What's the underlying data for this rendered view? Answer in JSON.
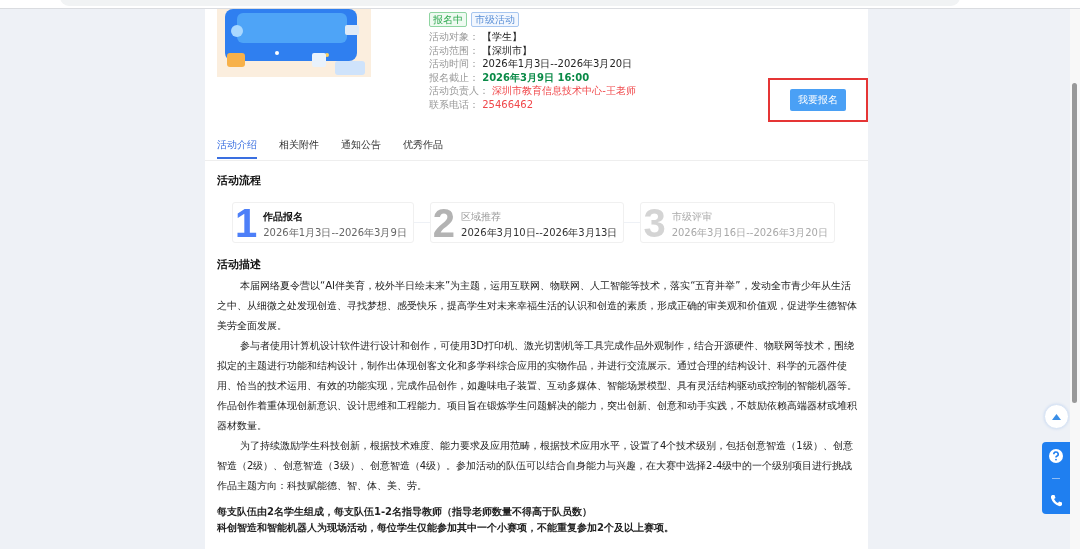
{
  "activity": {
    "tags": [
      {
        "label": "报名中",
        "kind": "status"
      },
      {
        "label": "市级活动",
        "kind": "level"
      }
    ],
    "info": [
      {
        "label": "活动对象：",
        "value": "【学生】",
        "kind": "plain"
      },
      {
        "label": "活动范围：",
        "value": "【深圳市】",
        "kind": "plain"
      },
      {
        "label": "活动时间：",
        "value": "2026年1月3日--2026年3月20日",
        "kind": "plain"
      },
      {
        "label": "报名截止：",
        "value": "2026年3月9日 16:00",
        "kind": "deadline"
      },
      {
        "label": "活动负责人：",
        "value": "深圳市教育信息技术中心-王老师",
        "kind": "contact"
      },
      {
        "label": "联系电话：",
        "value": "25466462",
        "kind": "contact"
      }
    ],
    "signup_button": {
      "label": "我要报名",
      "highlighted": true
    }
  },
  "tabs": [
    {
      "label": "活动介绍",
      "selected": true
    },
    {
      "label": "相关附件",
      "selected": false
    },
    {
      "label": "通知公告",
      "selected": false
    },
    {
      "label": "优秀作品",
      "selected": false
    }
  ],
  "process": {
    "title": "活动流程",
    "steps": [
      {
        "number": "1",
        "name": "作品报名",
        "dates": "2026年1月3日--2026年3月9日",
        "kind": "current"
      },
      {
        "number": "2",
        "name": "区域推荐",
        "dates": "2026年3月10日--2026年3月13日",
        "kind": "next"
      },
      {
        "number": "3",
        "name": "市级评审",
        "dates": "2026年3月16日--2026年3月20日",
        "kind": "future"
      }
    ]
  },
  "description": {
    "title": "活动描述",
    "paragraphs": [
      {
        "text": "本届网络夏令营以“AI伴美育，校外半日绘未来”为主题，运用互联网、物联网、人工智能等技术，落实“五育并举”，发动全市青少年从生活之中、从细微之处发现创造、寻找梦想、感受快乐，提高学生对未来幸福生活的认识和创造的素质，形成正确的审美观和价值观，促进学生德智体美劳全面发展。",
        "kind": "indent"
      },
      {
        "text": "参与者使用计算机设计软件进行设计和创作，可使用3D打印机、激光切割机等工具完成作品外观制作，结合开源硬件、物联网等技术，围绕拟定的主题进行功能和结构设计，制作出体现创客文化和多学科综合应用的实物作品，并进行交流展示。通过合理的结构设计、科学的元器件使用、恰当的技术运用、有效的功能实现，完成作品创作，如趣味电子装置、互动多媒体、智能场景模型、具有灵活结构驱动或控制的智能机器等。作品创作着重体现创新意识、设计思维和工程能力。项目旨在锻炼学生问题解决的能力，突出创新、创意和动手实践，不鼓励依赖高端器材或堆积器材数量。",
        "kind": "indent"
      },
      {
        "text": "为了持续激励学生科技创新，根据技术难度、能力要求及应用范畴，根据技术应用水平，设置了4个技术级别，包括创意智造（1级）、创意智造（2级）、创意智造（3级）、创意智造（4级）。参加活动的队伍可以结合自身能力与兴趣，在大赛中选择2-4级中的一个级别项目进行挑战作品主题方向：科技赋能德、智、体、美、劳。",
        "kind": "indent"
      },
      {
        "text": "每支队伍由2名学生组成，每支队伍1-2名指导教师（指导老师数量不得高于队员数）",
        "kind": "bold"
      },
      {
        "text": "科创智造和智能机器人为现场活动，每位学生仅能参加其中一个小赛项，不能重复参加2个及以上赛项。",
        "kind": "bold"
      }
    ]
  }
}
